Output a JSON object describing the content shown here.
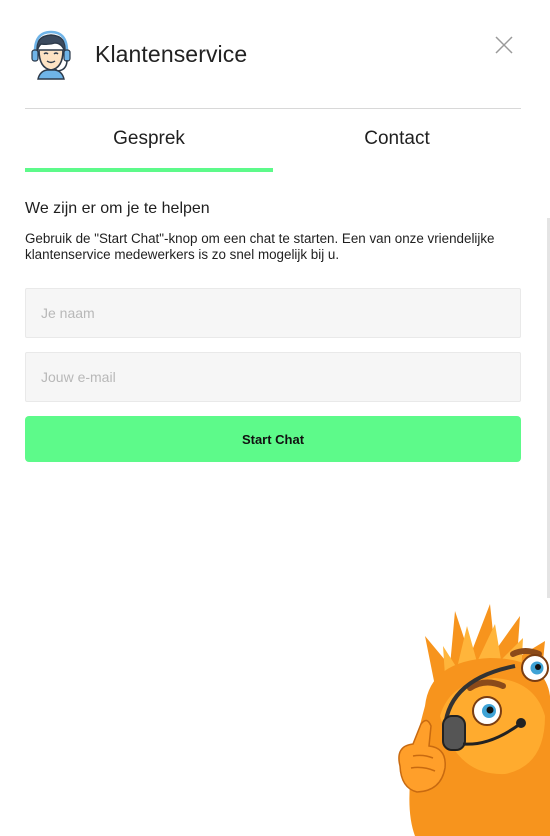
{
  "header": {
    "title": "Klantenservice",
    "avatar_icon": "support-agent-avatar-icon",
    "close_icon": "close-icon"
  },
  "tabs": [
    {
      "label": "Gesprek",
      "active": true
    },
    {
      "label": "Contact",
      "active": false
    }
  ],
  "intro": {
    "title": "We zijn er om je te helpen",
    "text": "Gebruik de \"Start Chat\"-knop om een chat te starten. Een van onze vriendelijke klantenservice medewerkers is zo snel mogelijk bij u."
  },
  "form": {
    "name_placeholder": "Je naam",
    "name_value": "",
    "email_placeholder": "Jouw e-mail",
    "email_value": "",
    "submit_label": "Start Chat"
  },
  "colors": {
    "accent": "#5dfa8a",
    "field_bg": "#f6f6f6"
  },
  "mascot": "orange-furry-monster-with-headset"
}
